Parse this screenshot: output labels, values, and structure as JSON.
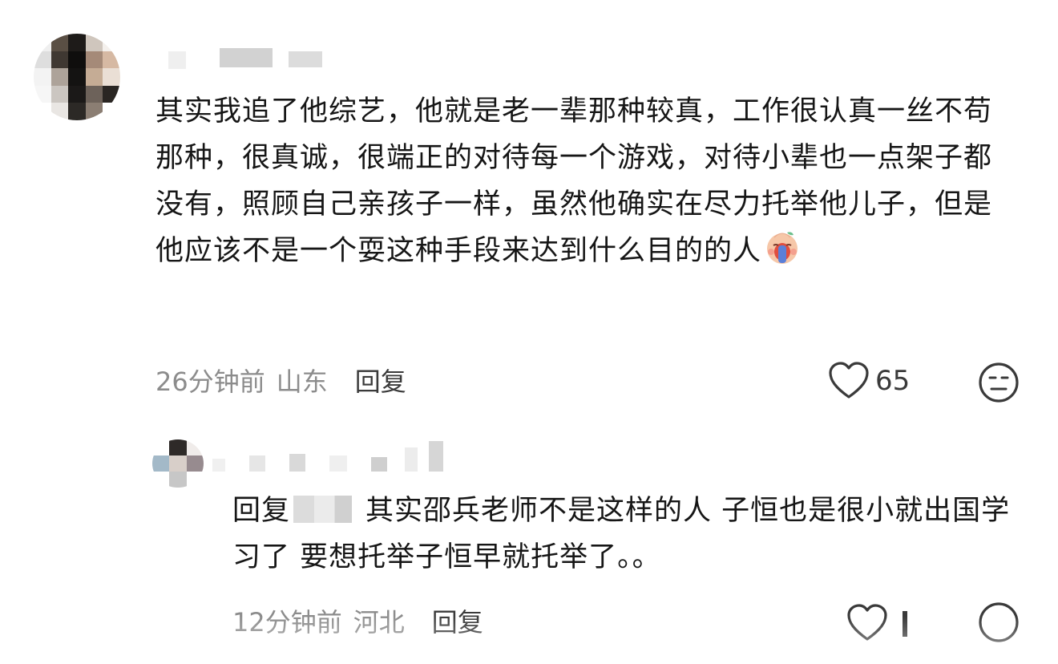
{
  "comments": [
    {
      "text": "其实我追了他综艺，他就是老一辈那种较真，工作很认真一丝不苟那种，很真诚，很端正的对待每一个游戏，对待小辈也一点架子都没有，照顾自己亲孩子一样，虽然他确实在尽力托举他儿子，但是他应该不是一个耍这种手段来达到什么目的的人",
      "emoji_icon": "crying-face-emoji-icon",
      "time": "26分钟前",
      "location": "山东",
      "reply_label": "回复",
      "like_count": "65"
    },
    {
      "reply_prefix": "回复",
      "text": "其实邵兵老师不是这样的人 子恒也是很小就出国学习了 要想托举子恒早就托举了。。",
      "time": "12分钟前",
      "location": "河北",
      "reply_label": "回复"
    }
  ],
  "colors": {
    "text": "#161616",
    "meta": "#8c8c8c",
    "icon": "#3a3a3a",
    "background": "#ffffff"
  }
}
